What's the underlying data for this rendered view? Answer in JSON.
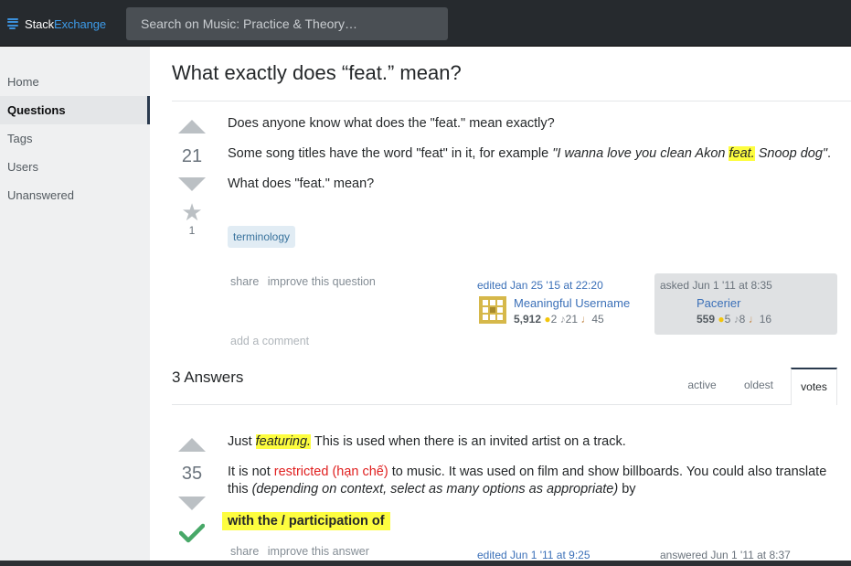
{
  "topbar": {
    "logo_stack": "Stack",
    "logo_exchange": "Exchange",
    "search_placeholder": "Search on Music: Practice & Theory…"
  },
  "sidebar": {
    "items": [
      {
        "label": "Home"
      },
      {
        "label": "Questions"
      },
      {
        "label": "Tags"
      },
      {
        "label": "Users"
      },
      {
        "label": "Unanswered"
      }
    ]
  },
  "question": {
    "title": "What exactly does “feat.” mean?",
    "votes": "21",
    "favorites": "1",
    "p1": "Does anyone know what does the \"feat.\" mean exactly?",
    "p2_prefix": "Some song titles have the word \"feat\" in it, for example ",
    "p2_q_before": "\"I wanna love you clean Akon ",
    "p2_q_hl": "feat.",
    "p2_q_after": " Snoop dog\"",
    "p2_end": ".",
    "p3": "What does \"feat.\" mean?",
    "tag": "terminology",
    "menu_share": "share",
    "menu_improve": "improve this question",
    "edited": "edited Jan 25 '15 at 22:20",
    "editor": {
      "name": "Meaningful Username",
      "rep": "5,912",
      "gold": "2",
      "silver": "21",
      "bronze": "45"
    },
    "asked": "asked Jun 1 '11 at 8:35",
    "asker": {
      "name": "Pacerier",
      "rep": "559",
      "gold": "5",
      "silver": "8",
      "bronze": "16"
    },
    "add_comment": "add a comment"
  },
  "answers": {
    "header": "3 Answers",
    "tabs": [
      {
        "label": "active"
      },
      {
        "label": "oldest"
      },
      {
        "label": "votes"
      }
    ]
  },
  "answer1": {
    "votes": "35",
    "p1_before": "Just ",
    "p1_hl": "featuring.",
    "p1_after": " This is used when there is an invited artist on a track.",
    "p2_before": "It is not ",
    "p2_red": "restricted (hạn chế)",
    "p2_mid": " to music. It was used on film and show billboards. You could also translate this ",
    "p2_em": "(depending on context, select as many options as appropriate)",
    "p2_after": " by",
    "bold_hl": "with the / participation of",
    "menu_share": "share",
    "menu_improve": "improve this answer",
    "edited": "edited Jun 1 '11 at 9:25",
    "answered": "answered Jun 1 '11 at 8:37"
  },
  "colors": {
    "topbar": "#262a2e",
    "accent": "#3d9be9",
    "highlight": "#fdfd3f",
    "accepted": "#48a868",
    "link": "#3b70b8"
  }
}
